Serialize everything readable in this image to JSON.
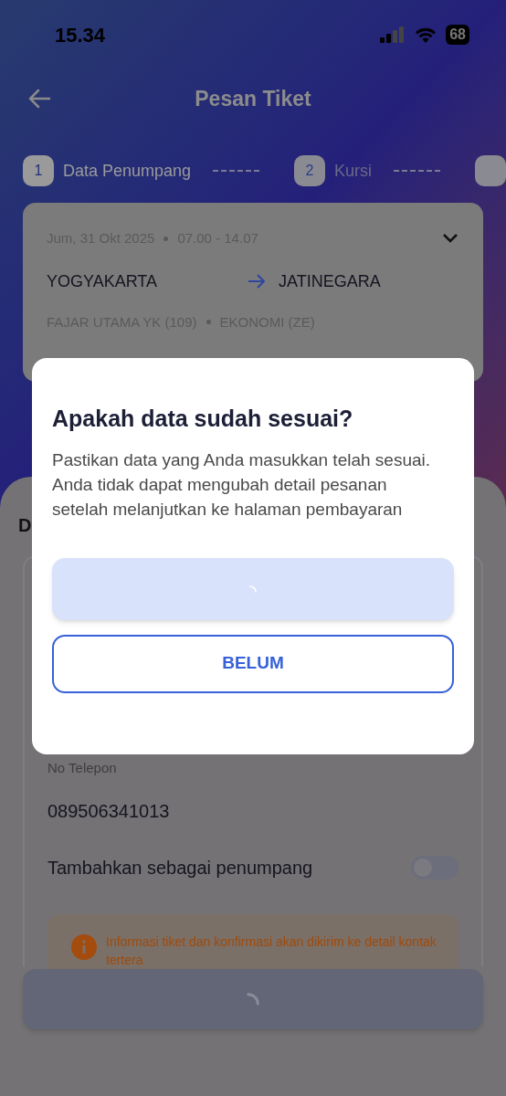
{
  "status_bar": {
    "time": "15.34",
    "battery": "68"
  },
  "header": {
    "title": "Pesan Tiket"
  },
  "steps": [
    {
      "number": "1",
      "label": "Data Penumpang",
      "selected": true
    },
    {
      "number": "2",
      "label": "Kursi",
      "selected": false
    },
    {
      "selected": false
    }
  ],
  "trip": {
    "date": "Jum, 31 Okt 2025",
    "time": "07.00 - 14.07",
    "origin": "YOGYAKARTA",
    "destination": "JATINEGARA",
    "train": "FAJAR UTAMA YK (109)",
    "class": "EKONOMI (ZE)",
    "expanded": false
  },
  "section_title": "D",
  "contact": {
    "phone_label": "No Telepon",
    "phone": "089506341013",
    "toggle_label": "Tambahkan sebagai penumpang",
    "toggle_on": false,
    "info": "Informasi tiket dan konfirmasi akan dikirim ke detail kontak tertera"
  },
  "footer": {
    "loading": true
  },
  "dialog": {
    "title": "Apakah data sudah sesuai?",
    "body": "Pastikan data yang Anda masukkan telah sesuai. Anda tidak dapat mengubah detail pesanan setelah melanjutkan ke halaman pembayaran",
    "confirm_loading": true,
    "cancel": "BELUM"
  }
}
